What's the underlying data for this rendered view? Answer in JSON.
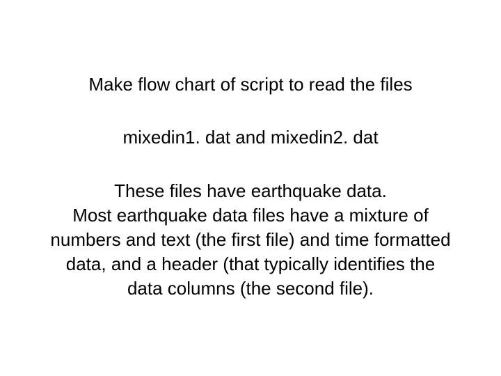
{
  "slide": {
    "title": "Make flow chart of script to read the files",
    "filenames": "mixedin1. dat and mixedin2. dat",
    "body_line1": "These files have earthquake data.",
    "body_line2": "Most earthquake data files have a mixture of",
    "body_line3": "numbers and text (the first file) and time formatted",
    "body_line4": "data, and a header (that typically identifies the",
    "body_line5": "data columns (the second file)."
  }
}
